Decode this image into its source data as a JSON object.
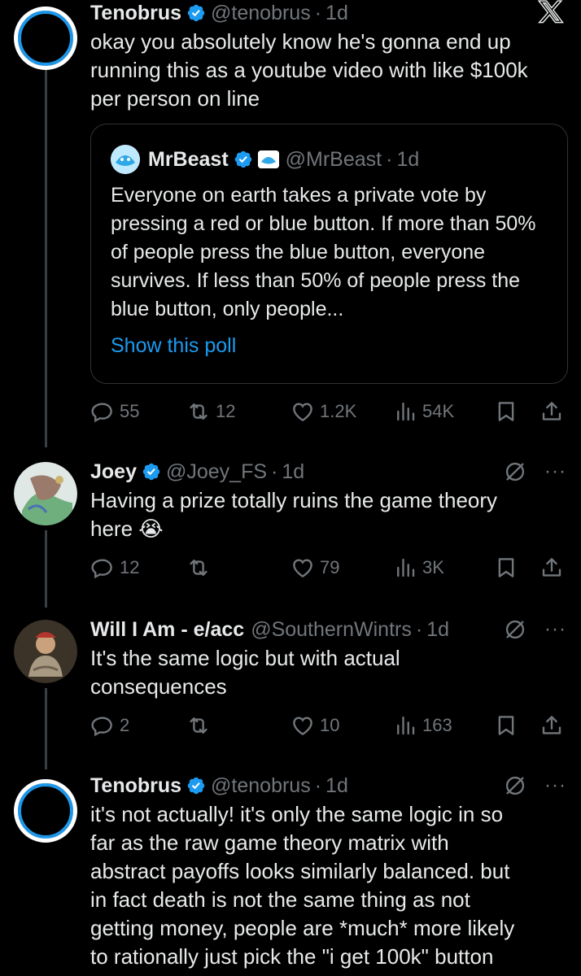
{
  "tweets": [
    {
      "name": "Tenobrus",
      "handle": "@tenobrus",
      "dot": "·",
      "time": "1d",
      "text": "okay you absolutely know he's gonna end up\nrunning this as a youtube video with like $100k\nper person on line",
      "replies": "55",
      "retweets": "12",
      "likes": "1.2K",
      "views": "54K",
      "quote": {
        "name": "MrBeast",
        "handle": "@MrBeast",
        "dot": "·",
        "time": "1d",
        "text": "Everyone on earth takes a private vote by pressing a red or blue button. If more than 50% of people press the blue button, everyone survives. If less than 50% of people press the blue button, only people...",
        "show_poll": "Show this poll"
      }
    },
    {
      "name": "Joey",
      "handle": "@Joey_FS",
      "dot": "·",
      "time": "1d",
      "text": "Having a prize totally ruins the game theory\nhere 😭",
      "replies": "12",
      "retweets": "",
      "likes": "79",
      "views": "3K"
    },
    {
      "name": "Will I Am - e/acc",
      "handle": "@SouthernWintrs",
      "dot": "·",
      "time": "1d",
      "text": "It's the same logic but with actual\nconsequences",
      "replies": "2",
      "retweets": "",
      "likes": "10",
      "views": "163"
    },
    {
      "name": "Tenobrus",
      "handle": "@tenobrus",
      "dot": "·",
      "time": "1d",
      "text": "it's not actually! it's only the same logic in so\nfar as the raw game theory matrix with\nabstract payoffs looks similarly balanced. but\nin fact death is not the same thing as not\ngetting money, people are *much* more likely\nto rationally just pick the \"i get 100k\" button"
    }
  ],
  "more_label": "···",
  "colors": {
    "accent": "#1d9bf0",
    "muted": "#71767b",
    "text": "#e7e9ea",
    "background": "#000000"
  }
}
